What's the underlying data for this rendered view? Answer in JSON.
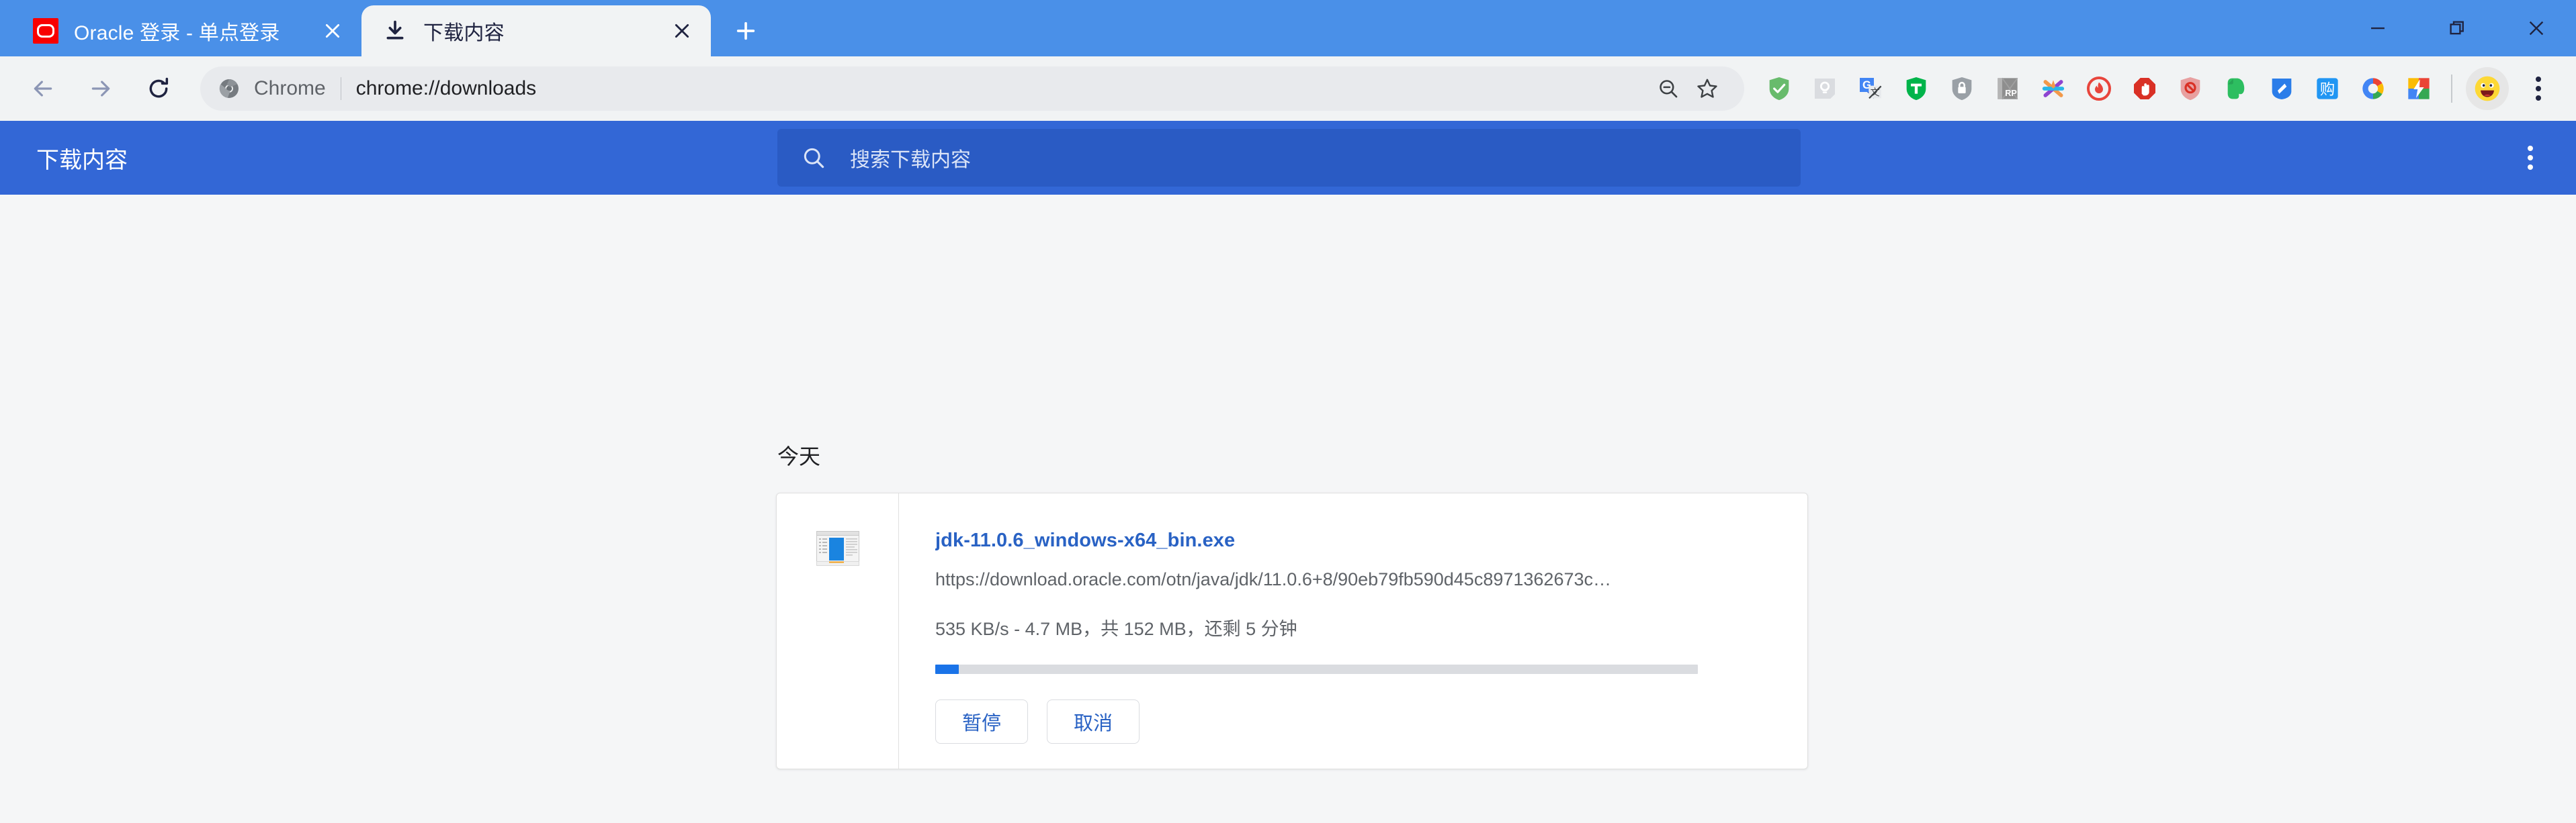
{
  "window": {
    "controls": {
      "minimize": "minimize-icon",
      "maximize": "maximize-icon",
      "close": "close-icon"
    }
  },
  "tabstrip": {
    "tabs": [
      {
        "title": "Oracle 登录 - 单点登录",
        "favicon": "oracle-favicon",
        "active": false,
        "close_label": "×"
      },
      {
        "title": "下载内容",
        "favicon": "download-favicon",
        "active": true,
        "close_label": "×"
      }
    ],
    "new_tab_label": "+"
  },
  "toolbar": {
    "back_label": "←",
    "forward_label": "→",
    "reload_label": "⟳",
    "omnibox": {
      "scheme_chip": "Chrome",
      "url": "chrome://downloads",
      "zoom_out_icon": "zoom-out-icon",
      "bookmark_icon": "star-icon"
    },
    "extensions": [
      {
        "name": "adguard-extension",
        "color": "#68bb6c"
      },
      {
        "name": "notes-extension",
        "color": "#dadce0"
      },
      {
        "name": "google-translate-extension",
        "color": "#4285f4"
      },
      {
        "name": "tampermonkey-extension",
        "color": "#00b44a"
      },
      {
        "name": "privacy-badger-extension",
        "color": "#9aa0a6"
      },
      {
        "name": "rp-reader-extension",
        "color": "#8e8e8e"
      },
      {
        "name": "star-multicolor-extension",
        "color": "#f2994a"
      },
      {
        "name": "flame-blocker-extension",
        "color": "#e8453c"
      },
      {
        "name": "adblock-stop-extension",
        "color": "#d93025"
      },
      {
        "name": "shield-block-extension",
        "color": "#e57373"
      },
      {
        "name": "evernote-extension",
        "color": "#2dbe60"
      },
      {
        "name": "blue-tag-extension",
        "color": "#1a73e8"
      },
      {
        "name": "shopping-extension",
        "color": "#2196f3"
      },
      {
        "name": "google-ring-extension",
        "color": "#4285f4"
      },
      {
        "name": "speed-extension",
        "color": "#fbbc05"
      }
    ],
    "avatar_label": "😄",
    "menu_label": "⋮"
  },
  "downloads_header": {
    "title": "下载内容",
    "search_placeholder": "搜索下载内容",
    "search_value": "",
    "more_label": "⋮"
  },
  "downloads": {
    "date_group": "今天",
    "items": [
      {
        "file_name": "jdk-11.0.6_windows-x64_bin.exe",
        "url": "https://download.oracle.com/otn/java/jdk/11.0.6+8/90eb79fb590d45c8971362673c…",
        "status": "535 KB/s - 4.7 MB，共 152 MB，还剩 5 分钟",
        "speed": "535 KB/s",
        "downloaded": "4.7 MB",
        "total_size": "152 MB",
        "time_remaining": "5 分钟",
        "progress_percent": 3.1,
        "icon": "exe-installer-icon",
        "buttons": [
          {
            "name": "pause-button",
            "label": "暂停"
          },
          {
            "name": "cancel-button",
            "label": "取消"
          }
        ]
      }
    ]
  },
  "colors": {
    "tabstrip_blue": "#4a90e8",
    "header_blue": "#3367d6",
    "search_blue": "#2a5bc4",
    "link_blue": "#2962c4",
    "progress_blue": "#1a73e8",
    "page_bg": "#f5f6f7",
    "toolbar_bg": "#f1f3f4"
  }
}
